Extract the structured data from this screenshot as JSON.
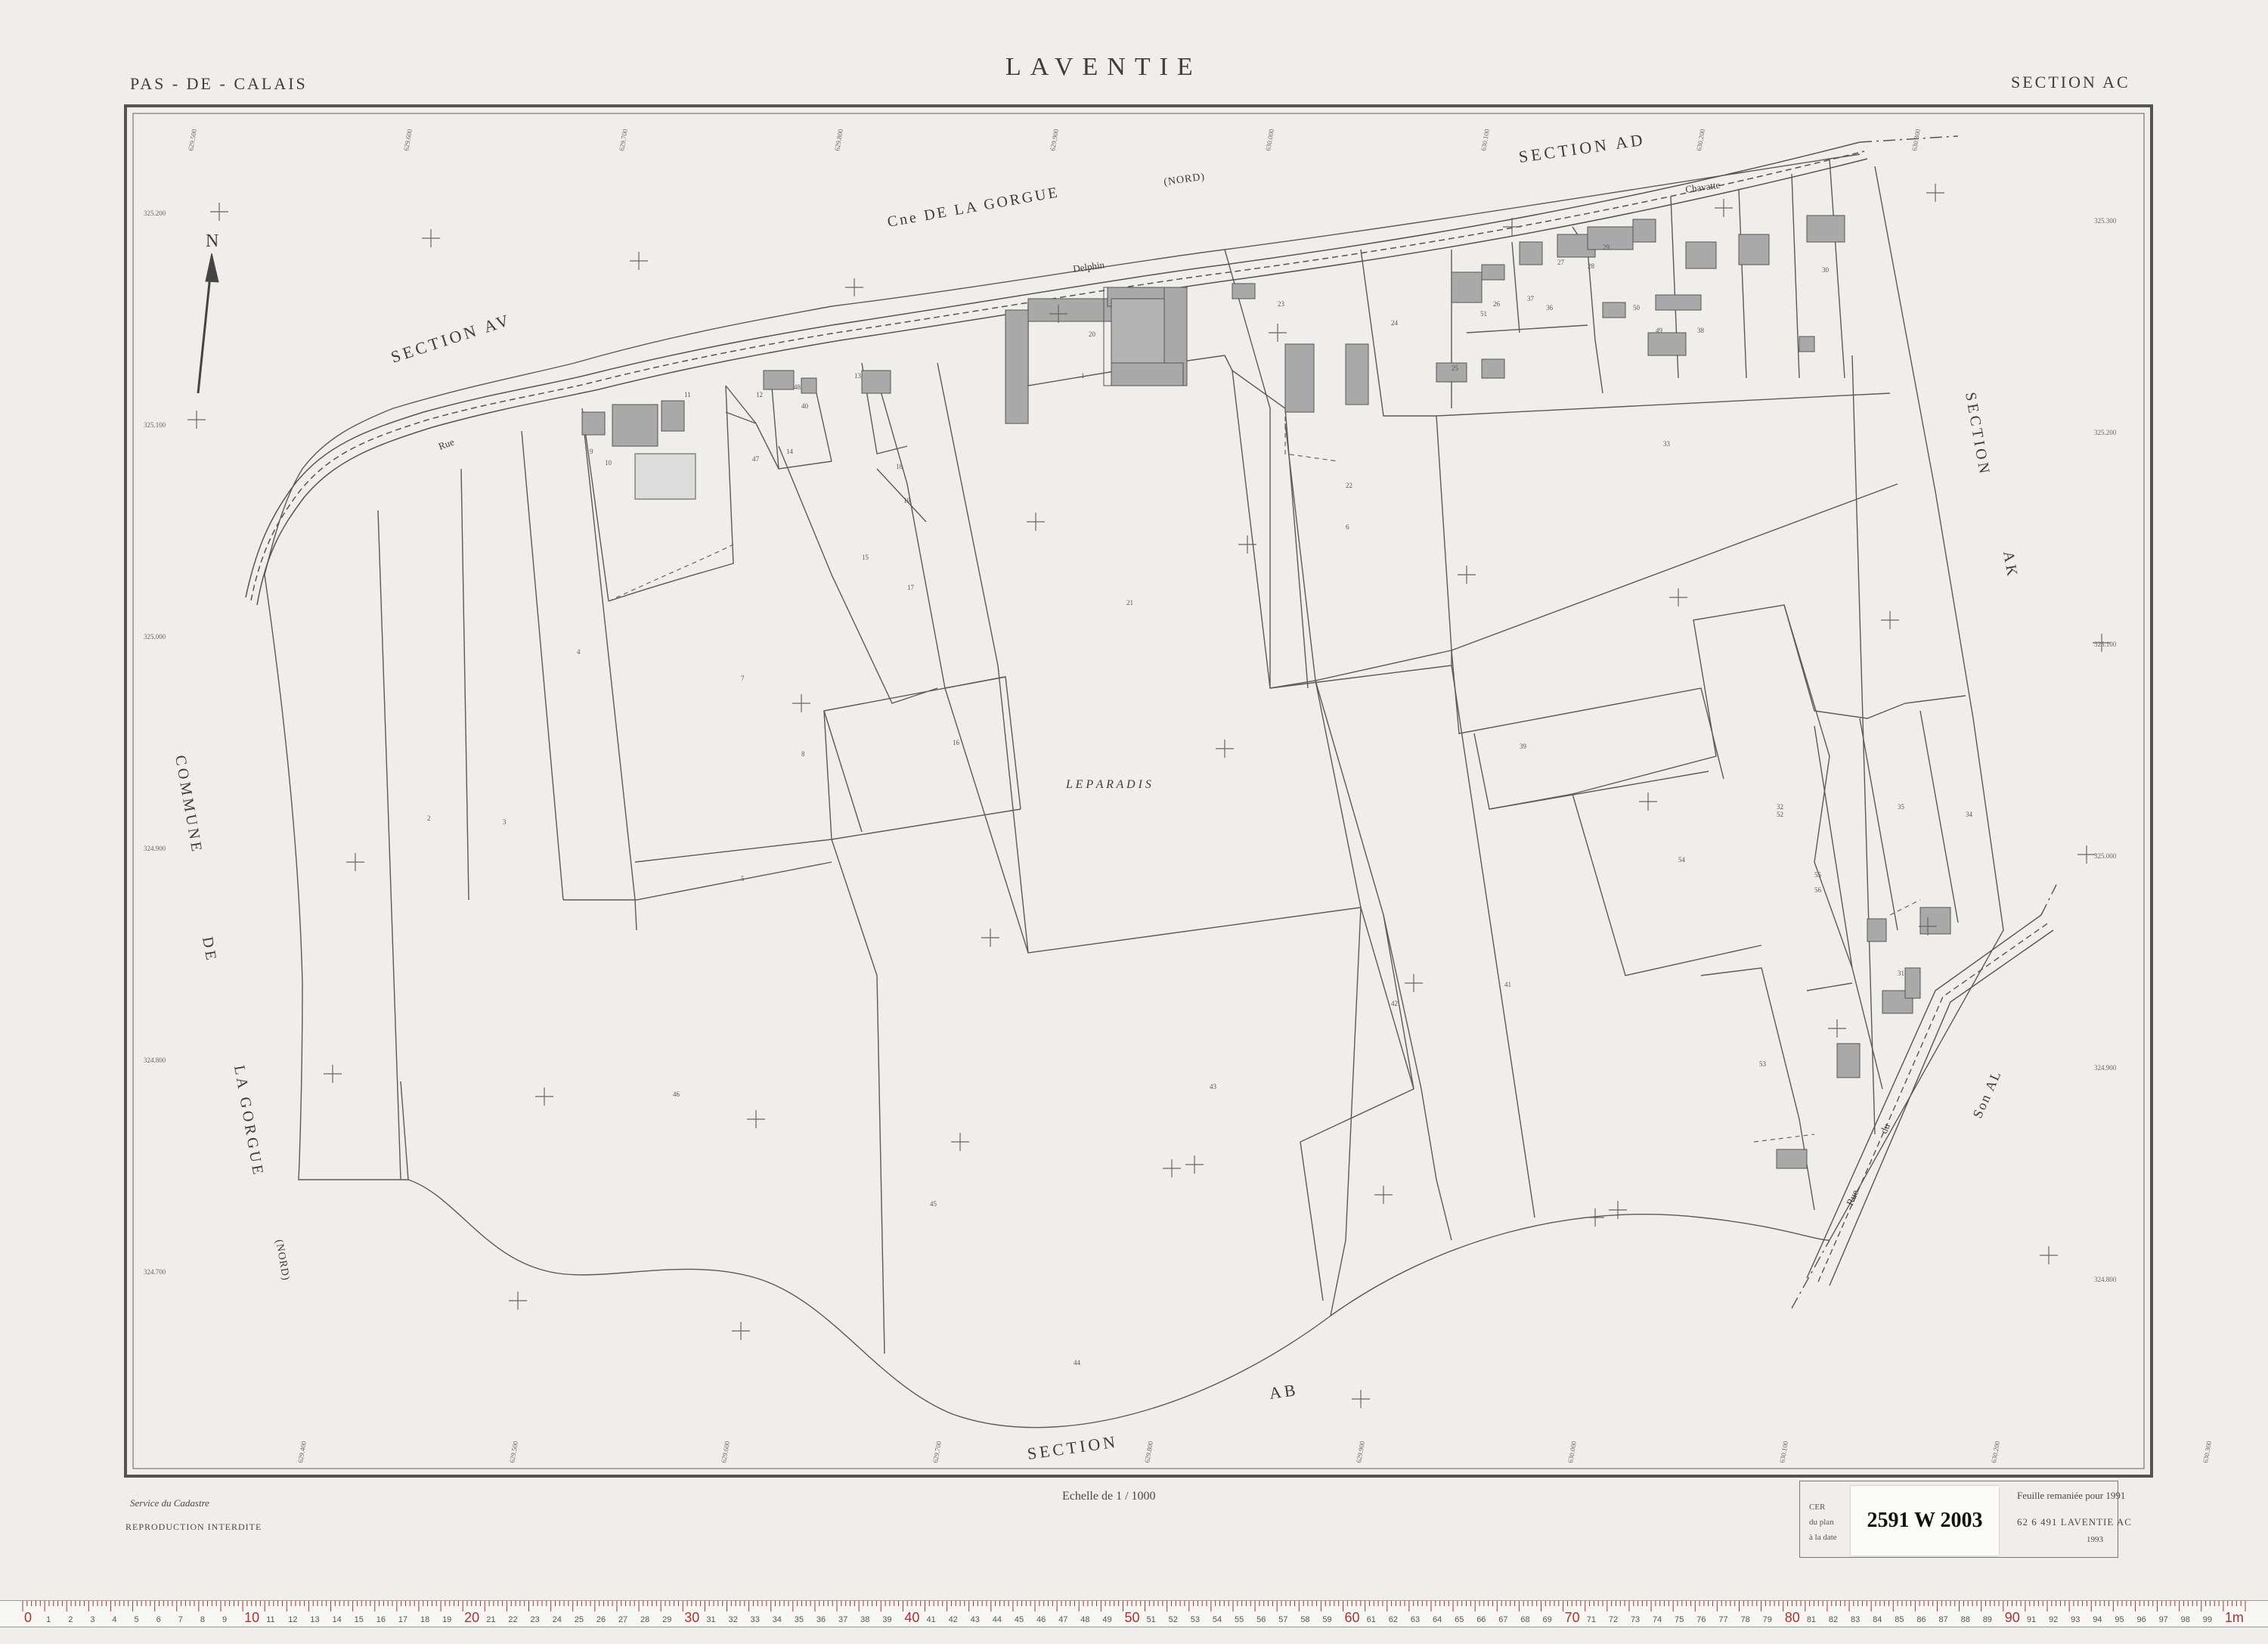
{
  "header": {
    "department": "PAS - DE - CALAIS",
    "commune": "LAVENTIE",
    "section": "SECTION  AC"
  },
  "map": {
    "labels": {
      "section_ad": "SECTION   AD",
      "section_av": "SECTION   AV",
      "section_ak_1": "SECTION",
      "section_ak_2": "AK",
      "section_ab_1": "SECTION",
      "section_ab_2": "AB",
      "gorgue": "Cne   DE   LA   GORGUE",
      "nord_top": "(NORD)",
      "commune_1": "COMMUNE",
      "commune_2": "DE",
      "commune_3": "LA  GORGUE",
      "nord_left": "(NORD)",
      "le_paradis": "L E    P A R A D I S",
      "north": "N",
      "rue_top": "Rue",
      "delphin": "Delphin",
      "chavatte": "Chavatte",
      "rue_bottom": "Rue",
      "du": "du",
      "sections_al": "Son  AL"
    },
    "parcel_numbers": [
      "1",
      "2",
      "3",
      "4",
      "5",
      "6",
      "7",
      "8",
      "9",
      "10",
      "11",
      "12",
      "13",
      "14",
      "15",
      "16",
      "17",
      "18",
      "19",
      "20",
      "21",
      "22",
      "23",
      "24",
      "25",
      "26",
      "27",
      "28",
      "29",
      "30",
      "31",
      "32",
      "33",
      "34",
      "35",
      "36",
      "37",
      "38",
      "39",
      "40",
      "41",
      "42",
      "43",
      "44",
      "45",
      "46",
      "47",
      "48",
      "49",
      "50",
      "51",
      "52",
      "53",
      "54",
      "55",
      "56"
    ],
    "grid_labels_top": [
      "629.500",
      "629.600",
      "629.700",
      "629.800",
      "629.900",
      "630.000",
      "630.100",
      "630.200",
      "630.300"
    ],
    "grid_labels_bottom": [
      "629.400",
      "629.500",
      "629.600",
      "629.700",
      "629.800",
      "629.900",
      "630.000",
      "630.100",
      "630.200",
      "630.300",
      "630.400"
    ],
    "grid_labels_left": [
      "325.200",
      "325.100",
      "325.000",
      "324.900",
      "324.800",
      "324.700"
    ],
    "grid_labels_right": [
      "325.300",
      "325.200",
      "325.100",
      "325.000",
      "324.900",
      "324.800"
    ]
  },
  "footer": {
    "service": "Service  du  Cadastre",
    "reproduction": "REPRODUCTION   INTERDITE",
    "scale": "Echelle  de  1 / 1000",
    "remaniee": "Feuille remaniée  pour  1991",
    "reference": "62  6  491   LAVENTIE   AC",
    "year": "1993",
    "cert_1": "CER",
    "cert_2": "du plan",
    "cert_3": "à la date"
  },
  "sticker": "2591 W 2003",
  "ruler": {
    "marks": [
      "0",
      "1",
      "2",
      "3",
      "4",
      "5",
      "6",
      "7",
      "8",
      "9",
      "10",
      "11",
      "12",
      "13",
      "14",
      "15",
      "16",
      "17",
      "18",
      "19",
      "20",
      "21",
      "22",
      "23",
      "24",
      "25",
      "26",
      "27",
      "28",
      "29",
      "30",
      "31",
      "32",
      "33",
      "34",
      "35",
      "36",
      "37",
      "38",
      "39",
      "40",
      "41",
      "42",
      "43",
      "44",
      "45",
      "46",
      "47",
      "48",
      "49",
      "50",
      "51",
      "52",
      "53",
      "54",
      "55",
      "56",
      "57",
      "58",
      "59",
      "60",
      "61",
      "62",
      "63",
      "64",
      "65",
      "66",
      "67",
      "68",
      "69",
      "70",
      "71",
      "72",
      "73",
      "74",
      "75",
      "76",
      "77",
      "78",
      "79",
      "80",
      "81",
      "82",
      "83",
      "84",
      "85",
      "86",
      "87",
      "88",
      "89",
      "90",
      "91",
      "92",
      "93",
      "94",
      "95",
      "96",
      "97",
      "98",
      "99",
      "1m"
    ]
  },
  "colors": {
    "ink": "#3a3a3a",
    "building_fill": "#a9a9a9",
    "paper": "#efeeeb"
  }
}
